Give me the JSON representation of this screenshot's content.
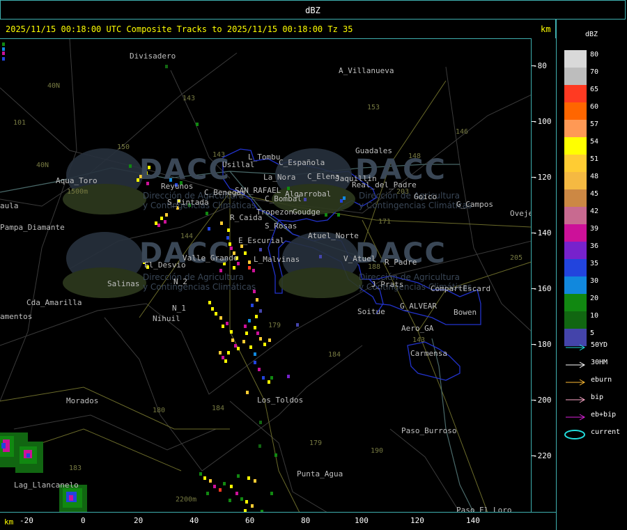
{
  "window": {
    "title": "dBZ"
  },
  "header": {
    "title": "2025/11/15 00:18:00 UTC Composite Tracks to 2025/11/15 00:18:00 Tz 35",
    "unit": "km"
  },
  "y_axis": {
    "ticks": [
      "-80",
      "-100",
      "-120",
      "-140",
      "-160",
      "-180",
      "-200",
      "-220"
    ]
  },
  "x_axis": {
    "unit": "km",
    "ticks": [
      "-20",
      "0",
      "20",
      "40",
      "60",
      "80",
      "100",
      "120",
      "140"
    ]
  },
  "colorbar": {
    "title": "dBZ",
    "levels": [
      {
        "label": "80",
        "color": "#d9d9d9"
      },
      {
        "label": "70",
        "color": "#bdbdbd"
      },
      {
        "label": "65",
        "color": "#ff3a22"
      },
      {
        "label": "60",
        "color": "#ff6600"
      },
      {
        "label": "57",
        "color": "#ff9955"
      },
      {
        "label": "54",
        "color": "#ffff00"
      },
      {
        "label": "51",
        "color": "#ffcc33"
      },
      {
        "label": "48",
        "color": "#f5b942"
      },
      {
        "label": "45",
        "color": "#cc8844"
      },
      {
        "label": "42",
        "color": "#c86a90"
      },
      {
        "label": "39",
        "color": "#cc1199"
      },
      {
        "label": "36",
        "color": "#7722cc"
      },
      {
        "label": "35",
        "color": "#2244dd"
      },
      {
        "label": "30",
        "color": "#1188dd"
      },
      {
        "label": "20",
        "color": "#118811"
      },
      {
        "label": "10",
        "color": "#116611"
      },
      {
        "label": "5",
        "color": "#4444aa"
      }
    ]
  },
  "track_legend": [
    {
      "label": "50YD",
      "color": "#22dddd",
      "icon": "arrow"
    },
    {
      "label": "30HM",
      "color": "#ffffff",
      "icon": "arrow"
    },
    {
      "label": "eburn",
      "color": "#ffbb33",
      "icon": "arrow"
    },
    {
      "label": "bip",
      "color": "#ffaacc",
      "icon": "arrow"
    },
    {
      "label": "eb+bip",
      "color": "#dd22dd",
      "icon": "arrow"
    },
    {
      "label": "current",
      "color": "#22dddd",
      "icon": "ellipse"
    }
  ],
  "watermark": {
    "logo_text": "DACC",
    "subtitle_line1": "Dirección de Agricultura",
    "subtitle_line2": "y Contingencias Climáticas"
  },
  "places": [
    "Divisadero",
    "A_Villanueva",
    "Guadales",
    "Usillal",
    "L_Tombu",
    "C_Española",
    "C_Elena",
    "Jaquillin",
    "Real_del_Padre",
    "Aqua_Toro",
    "Reyunos",
    "C_Benegas",
    "SAN_RAFAEL",
    "La_Nora",
    "C_Bombal",
    "Algarrobal",
    "Goico",
    "G_Campos",
    "Ovejeria",
    "aula",
    "Pampa_Diamante",
    "S_Pintada",
    "R_Caida",
    "Tropezon",
    "Goudge",
    "S_Rosas",
    "Atuel_Norte",
    "E_Escurial",
    "Valle_Grande",
    "El_Desvio",
    "L_Malvinas",
    "V_Atuel",
    "R_Padre",
    "J_Prats",
    "CompartEscard",
    "Salinas",
    "N_2",
    "Cda_Amarilla",
    "N_1",
    "Nihuil",
    "amentos",
    "Soitue",
    "G_ALVEAR",
    "Bowen",
    "Aero_GA",
    "Carmensa",
    "Morados",
    "Los_Toldos",
    "Paso_Burroso",
    "Punta_Agua",
    "Lag_Llancanelo",
    "Paso_El_Loro",
    "40N",
    "1500m",
    "2200m"
  ],
  "roads": [
    "143",
    "153",
    "146",
    "148",
    "101",
    "150",
    "143",
    "203",
    "171",
    "144",
    "188",
    "179",
    "184",
    "180",
    "184",
    "179",
    "190",
    "183",
    "143",
    "205",
    "40N"
  ]
}
